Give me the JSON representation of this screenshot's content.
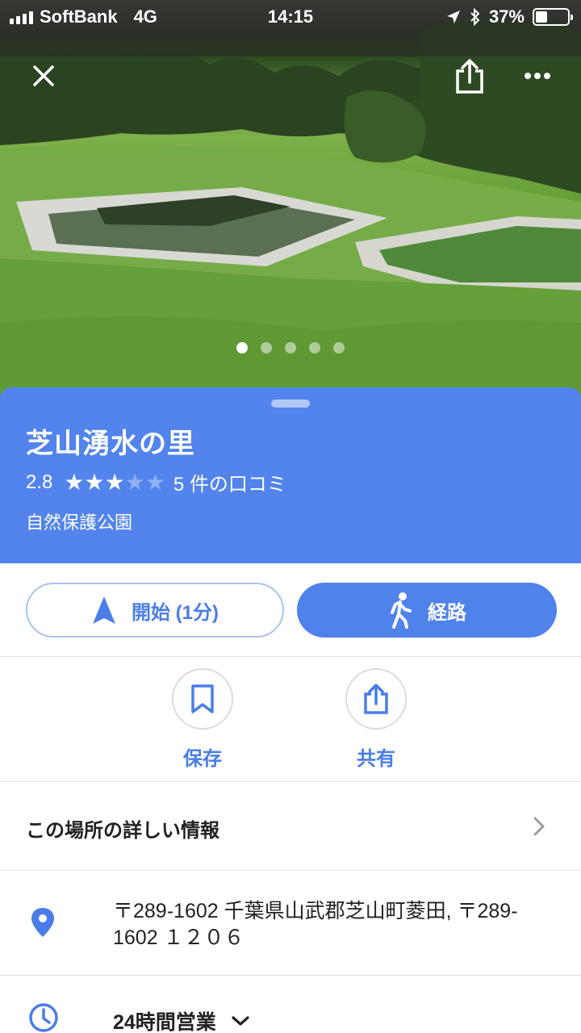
{
  "status_bar": {
    "carrier": "SoftBank",
    "network": "4G",
    "time": "14:15",
    "battery": "37%",
    "battery_level": 0.37,
    "icons": [
      "signal-icon",
      "location-arrow-icon",
      "bluetooth-icon",
      "battery-icon"
    ]
  },
  "hero": {
    "close_icon": "close-icon",
    "share_icon": "share-icon",
    "more_icon": "more-icon",
    "photo_count": 5,
    "active_photo": 1
  },
  "place": {
    "name": "芝山湧水の里",
    "rating": "2.8",
    "rating_value": 2.8,
    "stars_total": 5,
    "reviews": "5 件の口コミ",
    "category": "自然保護公園"
  },
  "actions": {
    "start_label": "開始 (1分)",
    "route_label": "経路",
    "save_label": "保存",
    "share_label": "共有"
  },
  "details": {
    "more_info_label": "この場所の詳しい情報",
    "address": "〒289-1602 千葉県山武郡芝山町菱田, 〒289-1602 １２０６",
    "hours": "24時間営業"
  },
  "colors": {
    "accent": "#5384ed",
    "button_blue": "#4f82eb",
    "text_dark": "#222222",
    "divider": "#e0e0e0"
  }
}
